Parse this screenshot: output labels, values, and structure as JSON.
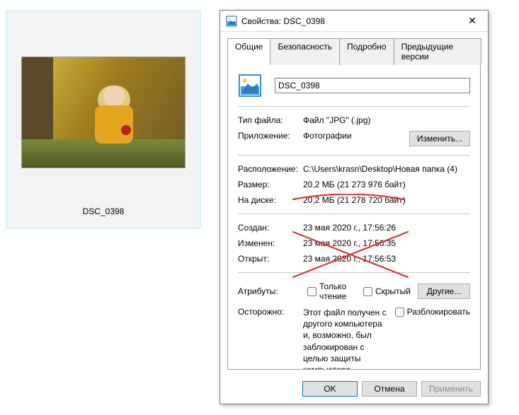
{
  "thumbnail": {
    "label": "DSC_0398"
  },
  "dialog": {
    "title_prefix": "Свойства: ",
    "title_name": "DSC_0398",
    "close_icon": "✕",
    "tabs": {
      "general": "Общие",
      "security": "Безопасность",
      "details": "Подробно",
      "previous": "Предыдущие версии"
    },
    "filename": "DSC_0398",
    "labels": {
      "filetype": "Тип файла:",
      "app": "Приложение:",
      "location": "Расположение:",
      "size": "Размер:",
      "ondisk": "На диске:",
      "created": "Создан:",
      "modified": "Изменен:",
      "accessed": "Открыт:",
      "attributes": "Атрибуты:",
      "caution": "Осторожно:"
    },
    "values": {
      "filetype": "Файл \"JPG\" (.jpg)",
      "app": "Фотографии",
      "location": "C:\\Users\\krasn\\Desktop\\Новая папка (4)",
      "size": "20,2 МБ (21 273 976 байт)",
      "ondisk": "20,2 МБ (21 278 720 байт)",
      "created": "‎23 ‎мая ‎2020 ‎г., ‏‎17:56:26",
      "modified": "‎23 ‎мая ‎2020 ‎г., ‏‎17:56:35",
      "accessed": "‎23 ‎мая ‎2020 ‎г., ‏‎17:56:53"
    },
    "buttons": {
      "change": "Изменить...",
      "other": "Другие...",
      "ok": "OK",
      "cancel": "Отмена",
      "apply": "Применить"
    },
    "checkboxes": {
      "readonly": "Только чтение",
      "hidden": "Скрытый",
      "unblock": "Разблокировать"
    },
    "caution_text": "Этот файл получен с другого компьютера и, возможно, был заблокирован с целью защиты компьютера."
  }
}
